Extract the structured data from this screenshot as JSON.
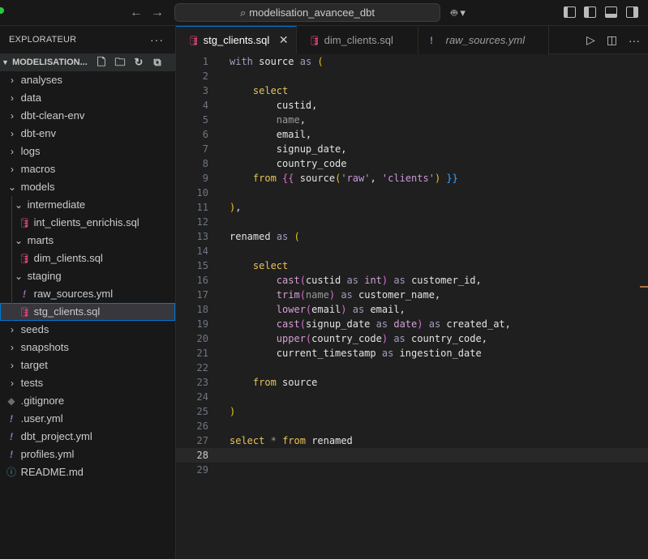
{
  "titlebar": {
    "search_text": "modelisation_avancee_dbt",
    "back_icon": "arrow-left-icon",
    "forward_icon": "arrow-right-icon"
  },
  "sidebar": {
    "title": "EXPLORATEUR",
    "root_folder": "MODELISATION...",
    "items": [
      {
        "label": "analyses",
        "type": "folder"
      },
      {
        "label": "data",
        "type": "folder"
      },
      {
        "label": "dbt-clean-env",
        "type": "folder"
      },
      {
        "label": "dbt-env",
        "type": "folder"
      },
      {
        "label": "logs",
        "type": "folder"
      },
      {
        "label": "macros",
        "type": "folder"
      },
      {
        "label": "models",
        "type": "folder-open"
      },
      {
        "label": "intermediate",
        "type": "folder-open"
      },
      {
        "label": "int_clients_enrichis.sql",
        "type": "sql"
      },
      {
        "label": "marts",
        "type": "folder-open"
      },
      {
        "label": "dim_clients.sql",
        "type": "sql"
      },
      {
        "label": "staging",
        "type": "folder-open"
      },
      {
        "label": "raw_sources.yml",
        "type": "yml"
      },
      {
        "label": "stg_clients.sql",
        "type": "sql"
      },
      {
        "label": "seeds",
        "type": "folder"
      },
      {
        "label": "snapshots",
        "type": "folder"
      },
      {
        "label": "target",
        "type": "folder"
      },
      {
        "label": "tests",
        "type": "folder"
      },
      {
        "label": ".gitignore",
        "type": "git"
      },
      {
        "label": ".user.yml",
        "type": "yml"
      },
      {
        "label": "dbt_project.yml",
        "type": "yml"
      },
      {
        "label": "profiles.yml",
        "type": "yml"
      },
      {
        "label": "README.md",
        "type": "info"
      }
    ]
  },
  "tabs": [
    {
      "label": "stg_clients.sql",
      "active": true
    },
    {
      "label": "dim_clients.sql",
      "active": false
    },
    {
      "label": "raw_sources.yml",
      "active": false
    }
  ],
  "editor": {
    "line_numbers": [
      "1",
      "2",
      "3",
      "4",
      "5",
      "6",
      "7",
      "8",
      "9",
      "10",
      "11",
      "12",
      "13",
      "14",
      "15",
      "16",
      "17",
      "18",
      "19",
      "20",
      "21",
      "22",
      "23",
      "24",
      "25",
      "26",
      "27",
      "28",
      "29"
    ],
    "current_line": 28,
    "lines": [
      "with source as (",
      "",
      "    select",
      "        custid,",
      "        name,",
      "        email,",
      "        signup_date,",
      "        country_code",
      "    from {{ source('raw', 'clients') }}",
      "",
      "),",
      "",
      "renamed as (",
      "",
      "    select",
      "        cast(custid as int) as customer_id,",
      "        trim(name) as customer_name,",
      "        lower(email) as email,",
      "        cast(signup_date as date) as created_at,",
      "        upper(country_code) as country_code,",
      "        current_timestamp as ingestion_date",
      "",
      "    from source",
      "",
      ")",
      "",
      "select * from renamed",
      "",
      ""
    ]
  }
}
